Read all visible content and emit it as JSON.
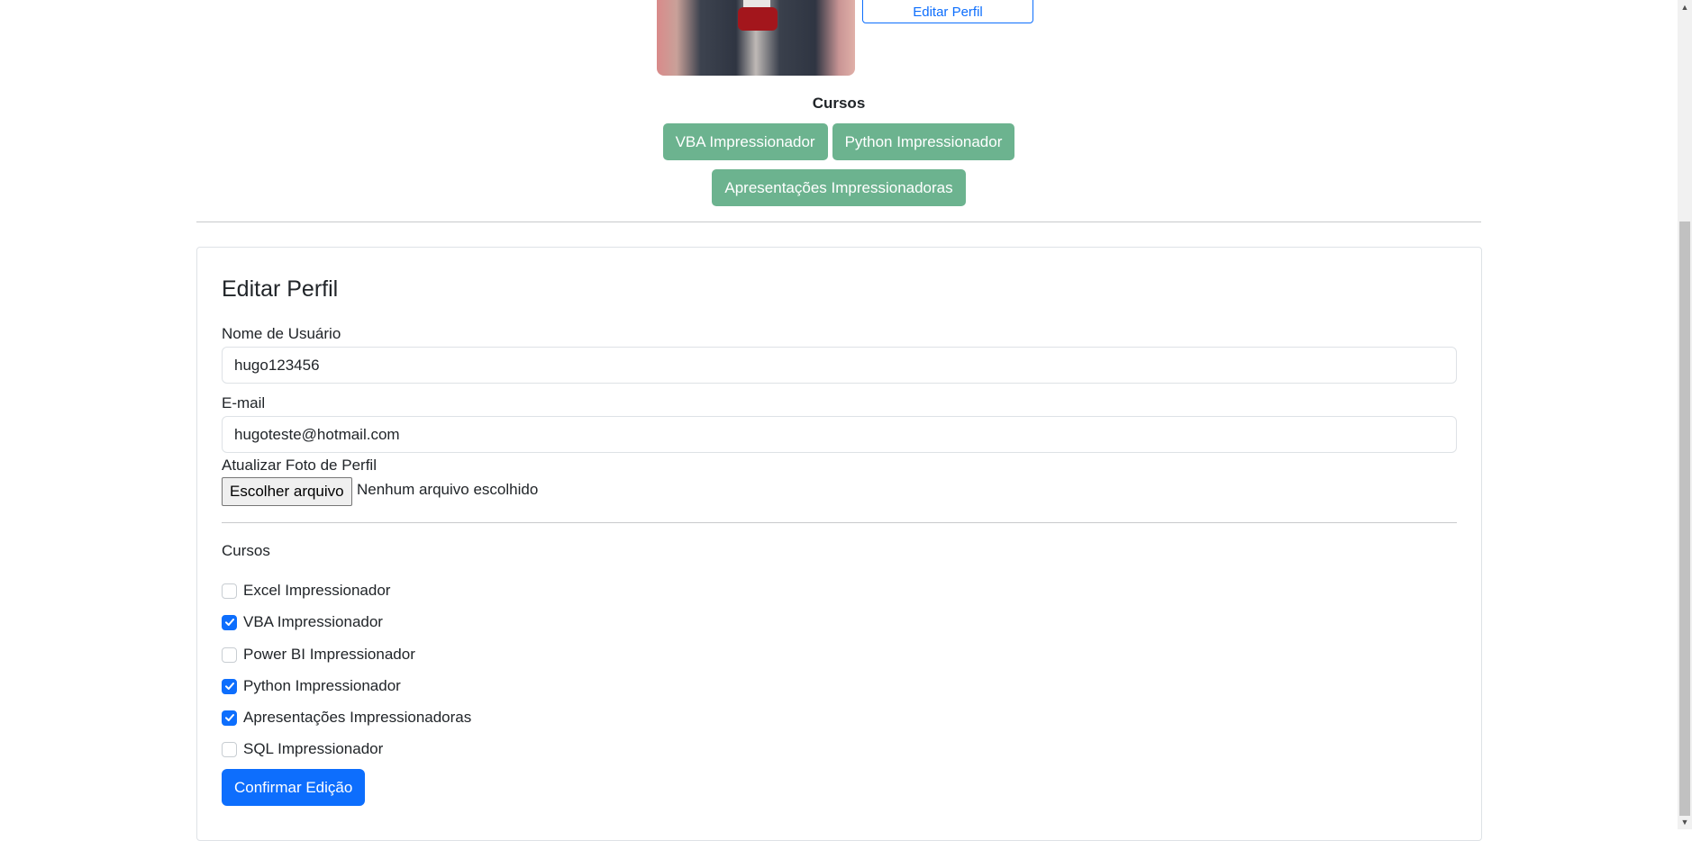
{
  "profile": {
    "edit_button": "Editar Perfil",
    "courses_heading": "Cursos",
    "courses": [
      "VBA Impressionador",
      "Python Impressionador",
      "Apresentações Impressionadoras"
    ]
  },
  "form": {
    "title": "Editar Perfil",
    "username_label": "Nome de Usuário",
    "username_value": "hugo123456",
    "email_label": "E-mail",
    "email_value": "hugoteste@hotmail.com",
    "photo_label": "Atualizar Foto de Perfil",
    "file_button": "Escolher arquivo",
    "file_status": "Nenhum arquivo escolhido",
    "courses_label": "Cursos",
    "checkboxes": [
      {
        "label": "Excel Impressionador",
        "checked": false
      },
      {
        "label": "VBA Impressionador",
        "checked": true
      },
      {
        "label": "Power BI Impressionador",
        "checked": false
      },
      {
        "label": "Python Impressionador",
        "checked": true
      },
      {
        "label": "Apresentações Impressionadoras",
        "checked": true
      },
      {
        "label": "SQL Impressionador",
        "checked": false
      }
    ],
    "submit": "Confirmar Edição"
  },
  "colors": {
    "primary": "#0d6efd",
    "course_badge": "#6cb38f"
  }
}
